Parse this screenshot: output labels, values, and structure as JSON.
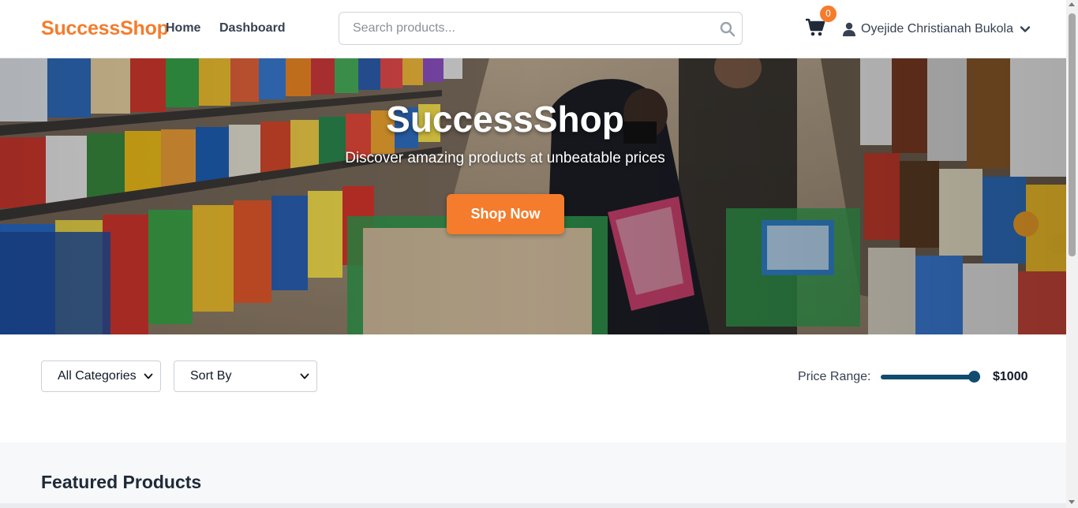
{
  "header": {
    "logo": "SuccessShop",
    "nav": [
      {
        "label": "Home"
      },
      {
        "label": "Dashboard"
      }
    ],
    "search": {
      "placeholder": "Search products...",
      "value": ""
    },
    "cart": {
      "count": "0",
      "icon": "shopping-cart-icon"
    },
    "user": {
      "name": "Oyejide Christianah Bukola",
      "icon": "user-icon",
      "menu_icon": "chevron-down-icon"
    }
  },
  "hero": {
    "title": "SuccessShop",
    "subtitle": "Discover amazing products at unbeatable prices",
    "cta_label": "Shop Now",
    "image": "grocery-store-aisle-photo"
  },
  "filters": {
    "category": {
      "selected": "All Categories"
    },
    "sort": {
      "selected": "Sort By"
    },
    "price_range": {
      "label": "Price Range:",
      "value_label": "$1000",
      "level": 1.0
    }
  },
  "featured": {
    "title": "Featured Products"
  },
  "colors": {
    "accent": "#f47c2c",
    "slider": "#0f4c6f",
    "text": "#1f2937"
  }
}
